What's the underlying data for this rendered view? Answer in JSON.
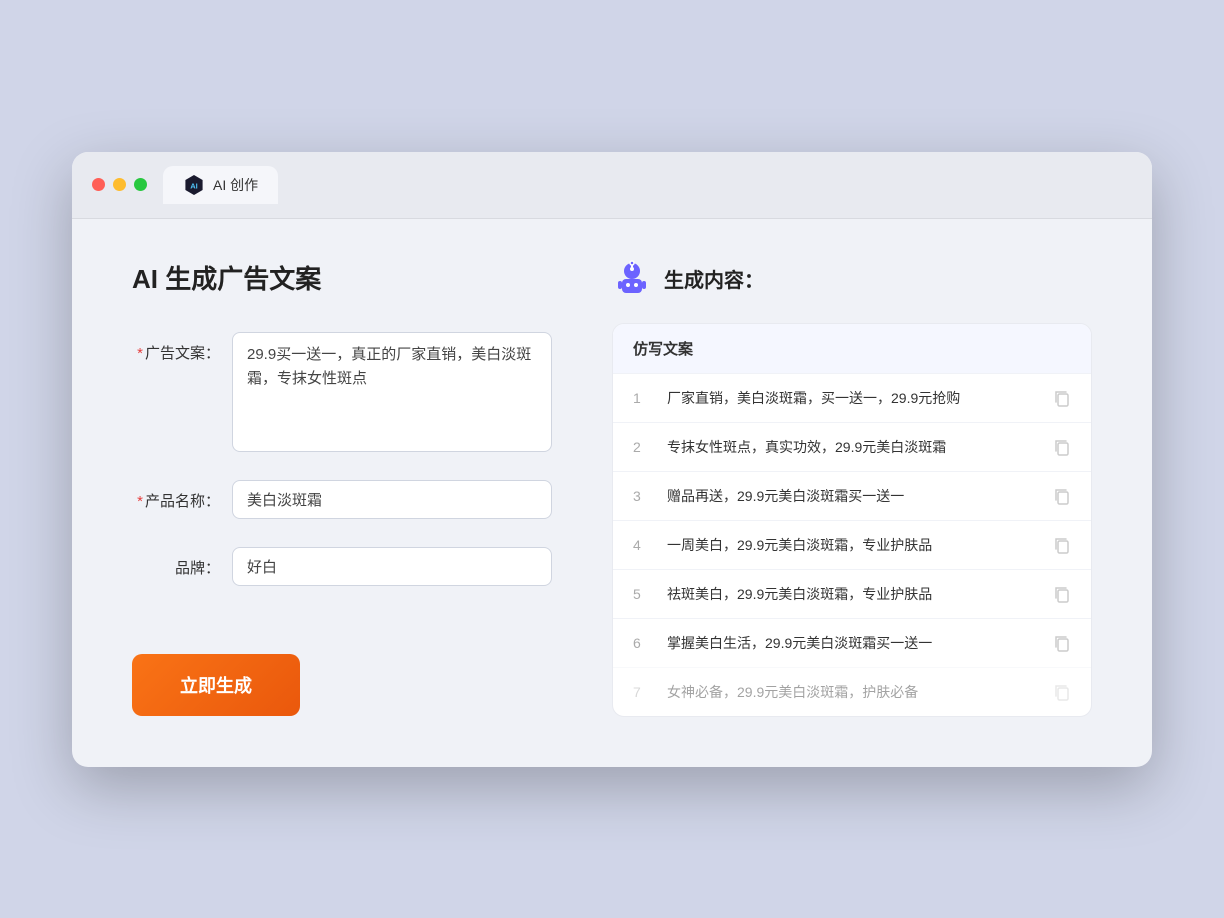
{
  "window": {
    "tab_label": "AI 创作"
  },
  "page": {
    "title": "AI 生成广告文案"
  },
  "form": {
    "ad_copy_label": "广告文案：",
    "ad_copy_required": "*",
    "ad_copy_value": "29.9买一送一，真正的厂家直销，美白淡斑霜，专抹女性斑点",
    "product_name_label": "产品名称：",
    "product_name_required": "*",
    "product_name_value": "美白淡斑霜",
    "brand_label": "品牌：",
    "brand_value": "好白",
    "generate_btn": "立即生成"
  },
  "result": {
    "header": "生成内容：",
    "table_col": "仿写文案",
    "items": [
      {
        "num": "1",
        "text": "厂家直销，美白淡斑霜，买一送一，29.9元抢购"
      },
      {
        "num": "2",
        "text": "专抹女性斑点，真实功效，29.9元美白淡斑霜"
      },
      {
        "num": "3",
        "text": "赠品再送，29.9元美白淡斑霜买一送一"
      },
      {
        "num": "4",
        "text": "一周美白，29.9元美白淡斑霜，专业护肤品"
      },
      {
        "num": "5",
        "text": "祛斑美白，29.9元美白淡斑霜，专业护肤品"
      },
      {
        "num": "6",
        "text": "掌握美白生活，29.9元美白淡斑霜买一送一"
      },
      {
        "num": "7",
        "text": "女神必备，29.9元美白淡斑霜，护肤必备",
        "dimmed": true
      }
    ]
  },
  "traffic_lights": {
    "close": "#ff5f57",
    "minimize": "#febc2e",
    "maximize": "#28c840"
  }
}
